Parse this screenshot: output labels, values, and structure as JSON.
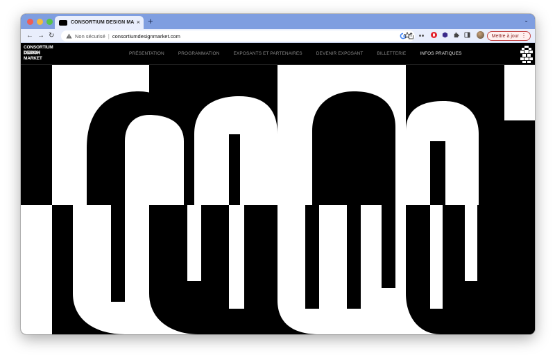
{
  "browser": {
    "tab": {
      "title": "CONSORTIUM DESIGN MARKET",
      "close": "×"
    },
    "new_tab": "+",
    "tab_menu": "⌄",
    "nav": {
      "back": "←",
      "forward": "→",
      "reload": "↻"
    },
    "address": {
      "security_icon": "warning-triangle-icon",
      "security_label": "Non sécurisé",
      "separator": "|",
      "url": "consortiumdesignmarket.com"
    },
    "update_button": "Mettre à jour",
    "menu_dots": "⋮",
    "icons": [
      "google-icon",
      "share-icon",
      "bookmark-star-icon",
      "bullet-icon",
      "opera-icon",
      "extension-hex-icon",
      "puzzle-icon",
      "sidepanel-icon",
      "profile-avatar"
    ]
  },
  "site": {
    "logo": {
      "line1": "CONSORTIUM",
      "line2": "DESIGN",
      "line3": "MARKET"
    },
    "menu": [
      {
        "label": "PRÉSENTATION",
        "active": false
      },
      {
        "label": "PROGRAMMATION",
        "active": false
      },
      {
        "label": "EXPOSANTS ET PARTENAIRES",
        "active": false
      },
      {
        "label": "DEVENIR EXPOSANT",
        "active": false
      },
      {
        "label": "BILLETTERIE",
        "active": false
      },
      {
        "label": "INFOS PRATIQUES",
        "active": true
      }
    ],
    "emblem": "emblem-logo",
    "hero_art": "checkerboard-type-art"
  },
  "colors": {
    "tabbar": "#7f9ee0",
    "toolbar": "#e9eefc",
    "site_bg": "#000000",
    "site_fg": "#ffffff",
    "menu_text": "#8a8a8a"
  }
}
